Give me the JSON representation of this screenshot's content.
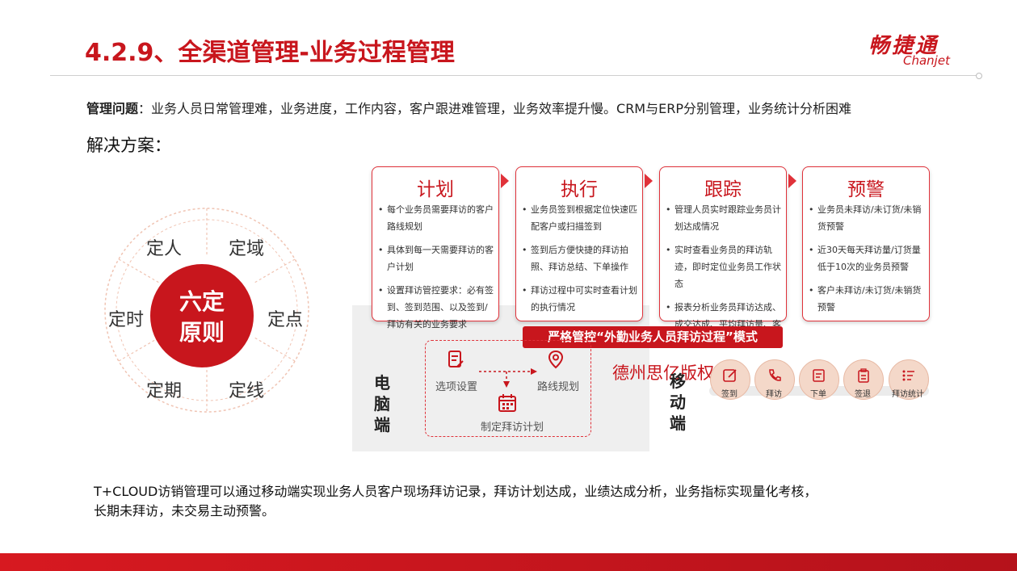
{
  "header": {
    "title": "4.2.9、全渠道管理-业务过程管理",
    "logo_cn": "畅捷通",
    "logo_en": "Chanjet"
  },
  "problem": {
    "label": "管理问题",
    "text": "：业务人员日常管理难，业务进度，工作内容，客户跟进难管理，业务效率提升慢。CRM与ERP分别管理，业务统计分析困难"
  },
  "solution_label": "解决方案：",
  "wheel": {
    "center_line1": "六定",
    "center_line2": "原则",
    "segments": [
      "定人",
      "定域",
      "定点",
      "定线",
      "定期",
      "定时"
    ]
  },
  "cards": [
    {
      "title": "计划",
      "items": [
        "每个业务员需要拜访的客户路线规划",
        "具体到每一天需要拜访的客户计划",
        "设置拜访管控要求：必有签到、签到范围、以及签到/拜访有关的业务要求"
      ]
    },
    {
      "title": "执行",
      "items": [
        "业务员签到根据定位快速匹配客户或扫描签到",
        "签到后方便快捷的拜访拍照、拜访总结、下单操作",
        "拜访过程中可实时查看计划的执行情况"
      ]
    },
    {
      "title": "跟踪",
      "items": [
        "管理人员实时跟踪业务员计划达成情况",
        "实时查看业务员的拜访轨迹，即时定位业务员工作状态",
        "报表分析业务员拜访达成、成交达成、平均拜访量、客户拜访频率等"
      ]
    },
    {
      "title": "预警",
      "items": [
        "业务员未拜访/未订货/未销货预警",
        "近30天每天拜访量/订货量低于10次的业务员预警",
        "客户未拜访/未订货/未销货预警"
      ]
    }
  ],
  "banner": "严格管控“外勤业务人员拜访过程”模式",
  "watermark": "德州思亿版权",
  "pc": {
    "label": "电脑端",
    "flow": {
      "step1": "选项设置",
      "step2": "路线规划",
      "step3": "制定拜访计划"
    }
  },
  "mobile": {
    "label": "移动端",
    "buttons": [
      "签到",
      "拜访",
      "下单",
      "签退",
      "拜访统计"
    ]
  },
  "bottom_text": {
    "line1": "T+CLOUD访销管理可以通过移动端实现业务人员客户现场拜访记录，拜访计划达成，业绩达成分析，业务指标实现量化考核，",
    "line2": "长期未拜访，未交易主动预警。"
  },
  "colors": {
    "brand_red": "#c8161d",
    "card_border": "#e0323a",
    "mobile_icon_bg": "#f4d8c9"
  }
}
